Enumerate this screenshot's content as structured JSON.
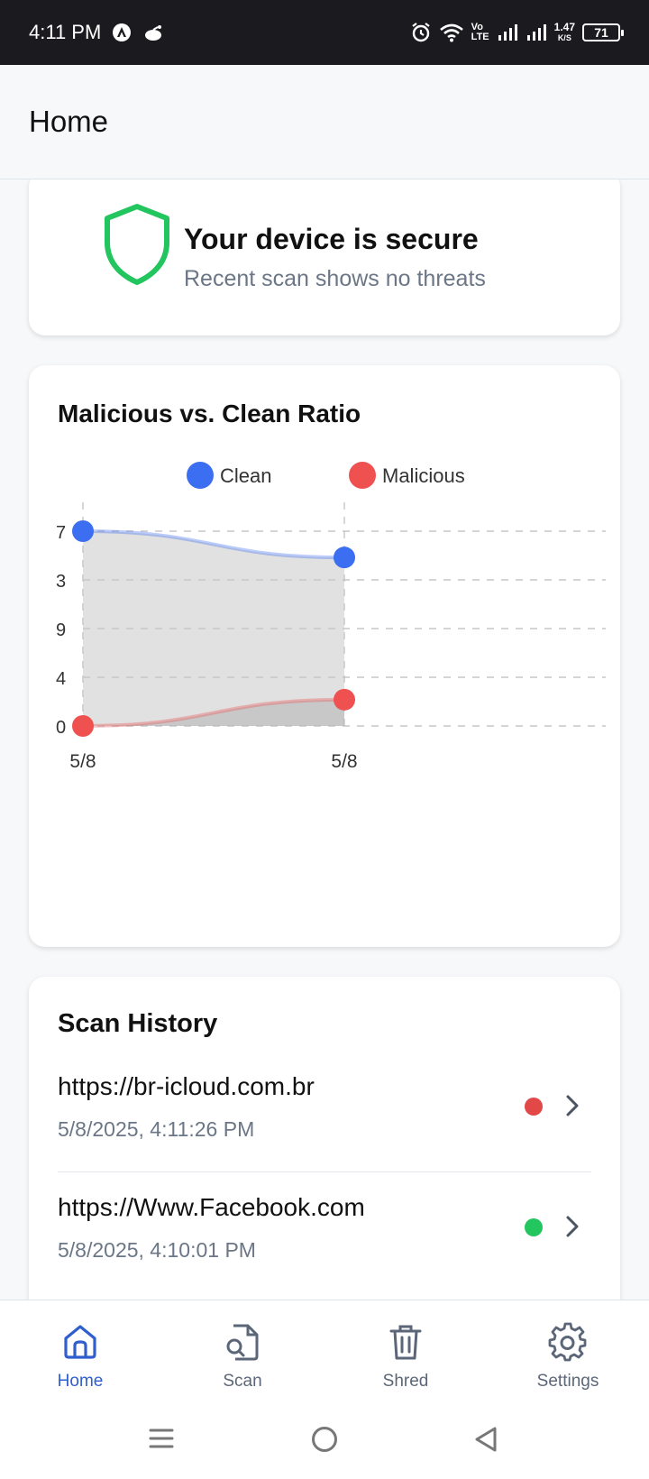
{
  "status_bar": {
    "time": "4:11 PM",
    "network_speed_value": "1.47",
    "network_speed_unit": "K/S",
    "battery": "71",
    "volte": "Vo",
    "lte": "LTE"
  },
  "header": {
    "title": "Home"
  },
  "security": {
    "title": "Your device is secure",
    "subtitle": "Recent scan shows no threats",
    "icon": "shield-icon",
    "color": "#22c55e"
  },
  "chart": {
    "title": "Malicious vs. Clean Ratio",
    "y_ticks": [
      "0",
      "4",
      "9",
      "3",
      "7"
    ],
    "legend": [
      {
        "label": "Clean",
        "color": "#3b6ef0"
      },
      {
        "label": "Malicious",
        "color": "#ef5151"
      }
    ]
  },
  "chart_data": {
    "type": "area",
    "title": "Malicious vs. Clean Ratio",
    "categories": [
      "5/8",
      "5/8"
    ],
    "series": [
      {
        "name": "Clean",
        "values": [
          20,
          17.3
        ]
      },
      {
        "name": "Malicious",
        "values": [
          0,
          2.7
        ]
      }
    ],
    "ylim": [
      0,
      20
    ],
    "grid": true,
    "legend_position": "top"
  },
  "history": {
    "title": "Scan History",
    "items": [
      {
        "url": "https://br-icloud.com.br",
        "time": "5/8/2025, 4:11:26 PM",
        "status": "malicious",
        "status_color": "#e34848"
      },
      {
        "url": "https://Www.Facebook.com",
        "time": "5/8/2025, 4:10:01 PM",
        "status": "clean",
        "status_color": "#22c55e"
      }
    ]
  },
  "nav": {
    "items": [
      {
        "label": "Home",
        "icon": "home-icon",
        "active": true
      },
      {
        "label": "Scan",
        "icon": "scan-file-icon",
        "active": false
      },
      {
        "label": "Shred",
        "icon": "trash-icon",
        "active": false
      },
      {
        "label": "Settings",
        "icon": "gear-icon",
        "active": false
      }
    ]
  },
  "colors": {
    "accent": "#2f5fcf",
    "muted": "#6b7686"
  }
}
